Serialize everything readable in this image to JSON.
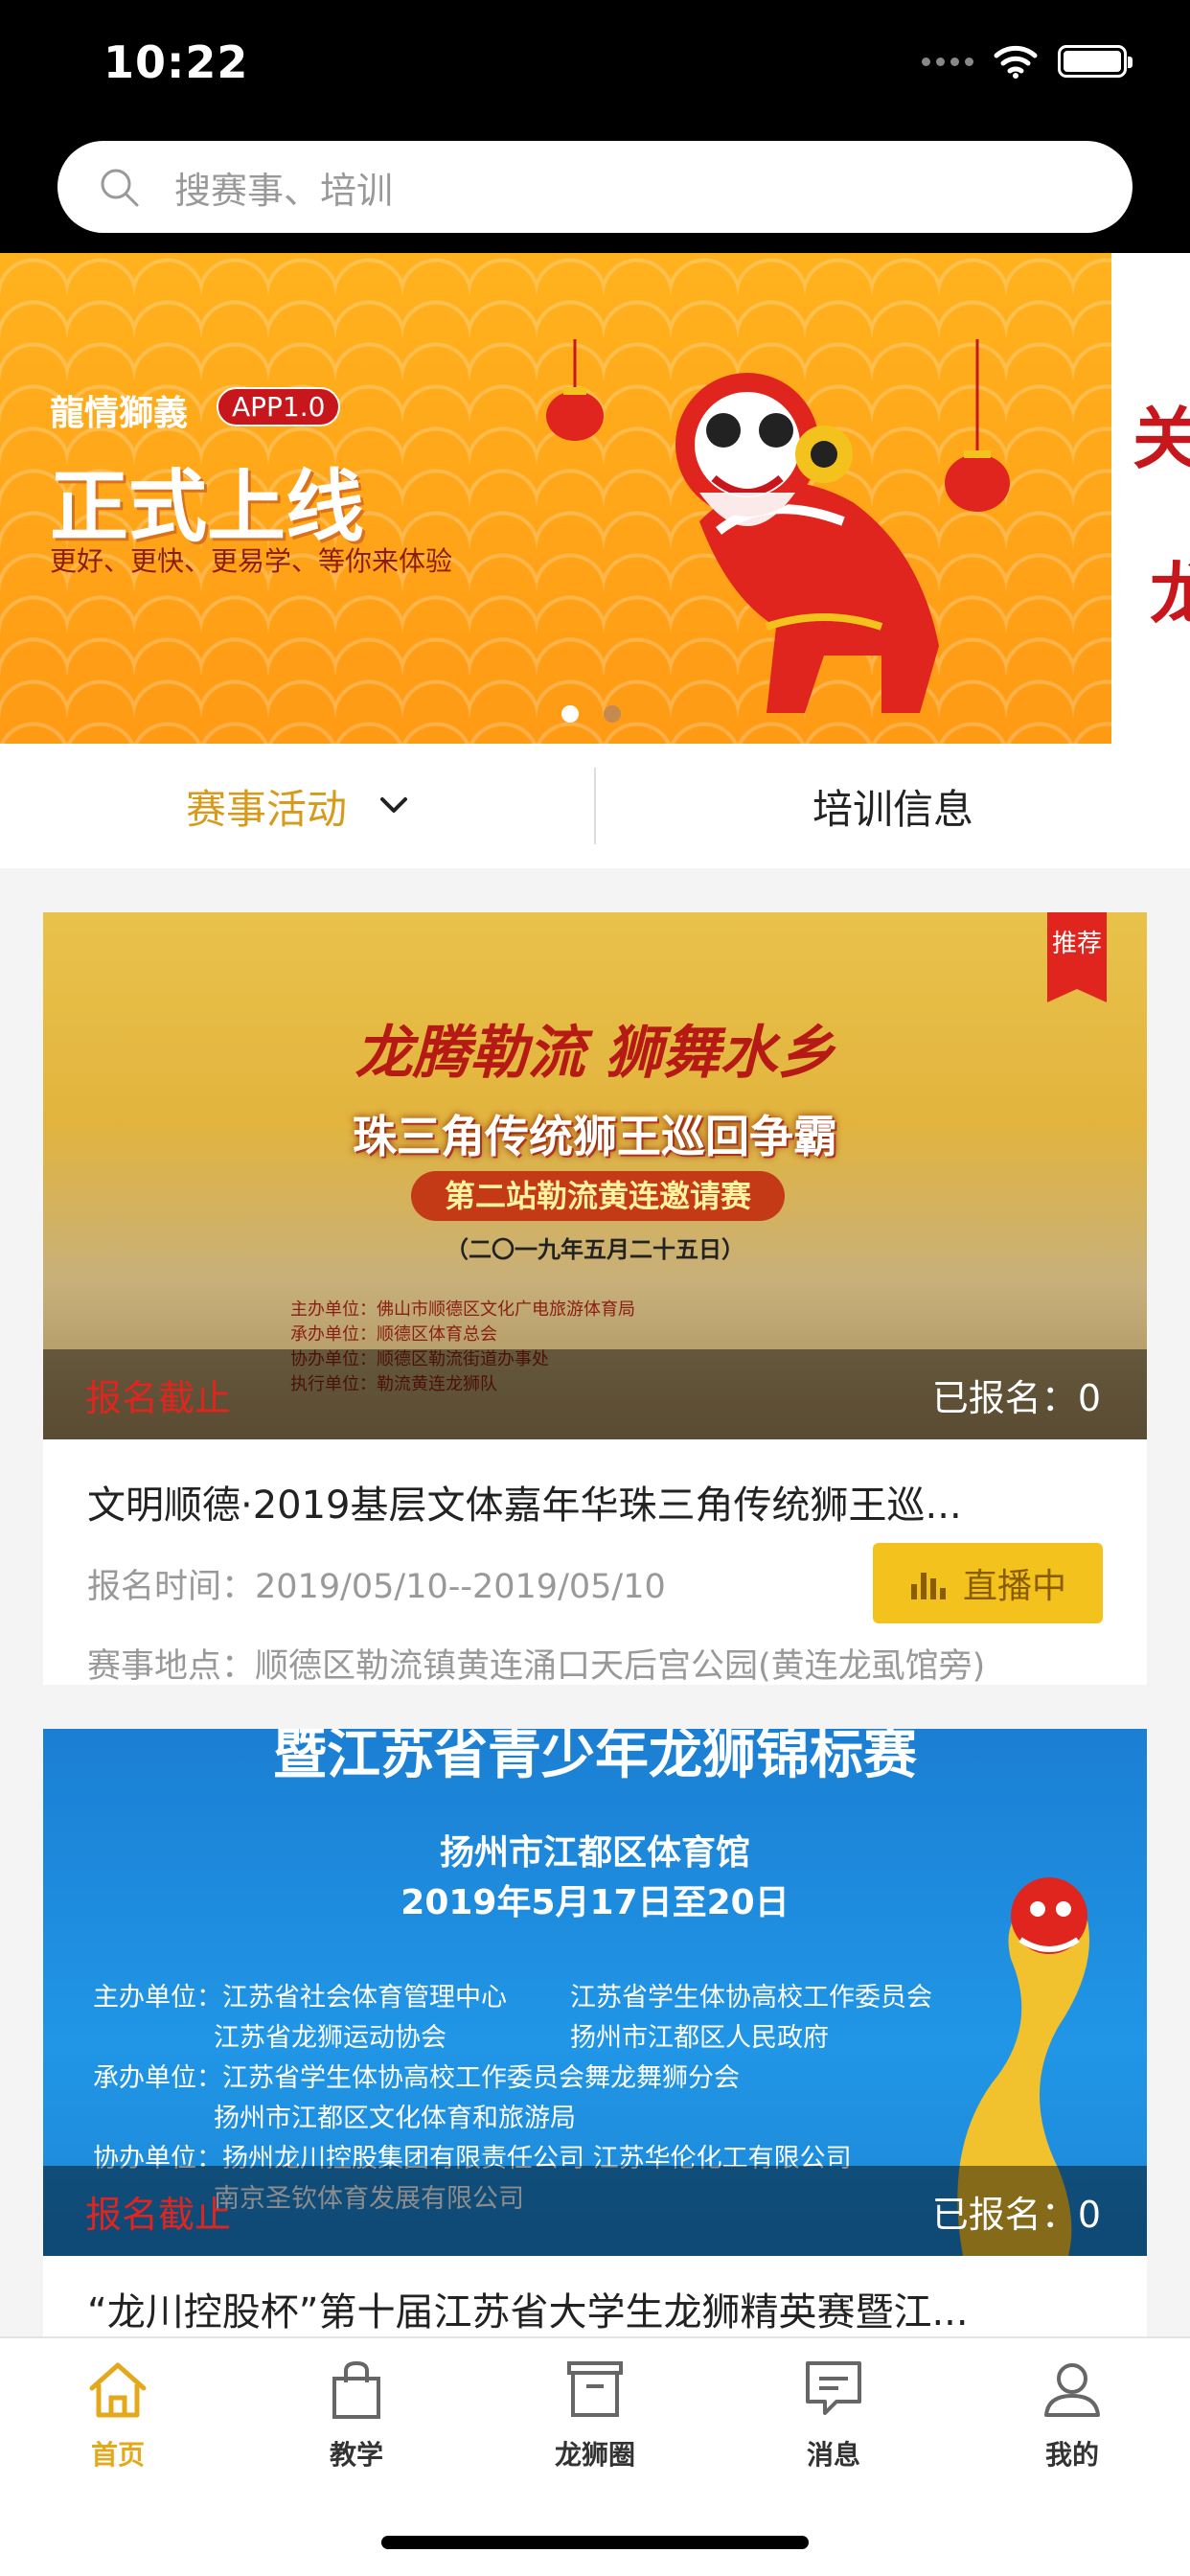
{
  "status": {
    "time": "10:22"
  },
  "search": {
    "placeholder": "搜赛事、培训"
  },
  "banner": {
    "brand": "龍情獅義",
    "app_tag": "APP1.0",
    "headline": "正式上线",
    "subline": "更好、更快、更易学、等你来体验",
    "next_slide_chars": [
      "关",
      "龙"
    ],
    "dots_total": 2,
    "dots_active": 1
  },
  "tabs": [
    {
      "label": "赛事活动",
      "active": true
    },
    {
      "label": "培训信息",
      "active": false
    }
  ],
  "events": [
    {
      "badge": "推荐",
      "status": "报名截止",
      "signed_label": "已报名：",
      "signed_count": "0",
      "title": "文明顺德·2019基层文体嘉年华珠三角传统狮王巡...",
      "time_label": "报名时间：",
      "time_value": "2019/05/10--2019/05/10",
      "place_label": "赛事地点：",
      "place_value": "顺德区勒流镇黄连涌口天后宫公园(黄连龙虱馆旁)",
      "live_label": "直播中",
      "poster": {
        "line1": "龙腾勒流  狮舞水乡",
        "line2": "珠三角传统狮王巡回争霸",
        "line3": "第二站勒流黄连邀请赛",
        "line4": "（二〇一九年五月二十五日）",
        "small": [
          "主办单位：佛山市顺德区文化广电旅游体育局",
          "承办单位：顺德区体育总会",
          "协办单位：顺德区勒流街道办事处",
          "执行单位：勒流黄连龙狮队"
        ]
      }
    },
    {
      "status": "报名截止",
      "signed_label": "已报名：",
      "signed_count": "0",
      "title": "“龙川控股杯”第十届江苏省大学生龙狮精英赛暨江...",
      "poster": {
        "line1": "暨江苏省青少年龙狮锦标赛",
        "line2": "扬州市江都区体育馆",
        "line3": "2019年5月17日至20日",
        "org": [
          "主办单位：江苏省社会体育管理中心",
          "江苏省学生体协高校工作委员会",
          "江苏省龙狮运动协会",
          "扬州市江都区人民政府",
          "承办单位：江苏省学生体协高校工作委员会舞龙舞狮分会",
          "扬州市江都区文化体育和旅游局",
          "协办单位：扬州龙川控股集团有限责任公司  江苏华伦化工有限公司",
          "南京圣钦体育发展有限公司"
        ]
      }
    }
  ],
  "tabbar": [
    {
      "label": "首页",
      "icon": "home-icon",
      "active": true
    },
    {
      "label": "教学",
      "icon": "bag-icon",
      "active": false
    },
    {
      "label": "龙狮圈",
      "icon": "box-icon",
      "active": false
    },
    {
      "label": "消息",
      "icon": "message-icon",
      "active": false
    },
    {
      "label": "我的",
      "icon": "user-icon",
      "active": false
    }
  ],
  "colors": {
    "accent": "#e3a91b",
    "live": "#f4c21d",
    "closed": "#e0251f"
  }
}
